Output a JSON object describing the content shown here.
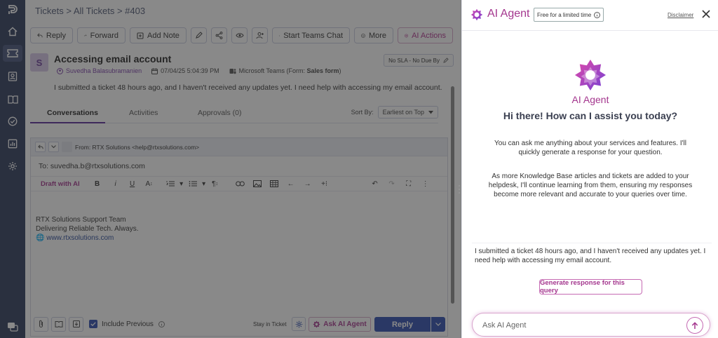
{
  "breadcrumb": {
    "tickets": "Tickets",
    "sep1": " > ",
    "all": "All Tickets",
    "sep2": " > ",
    "id": "#403"
  },
  "toolbar": {
    "reply": "Reply",
    "forward": "Forward",
    "add_note": "Add Note",
    "start_teams_chat": "Start Teams Chat",
    "more": "More",
    "ai_actions": "AI Actions"
  },
  "ticket": {
    "avatar_letter": "S",
    "subject": "Accessing email account",
    "requester": "Suvedha Balasubramanien",
    "datetime": "07/04/25 5:04:39 PM",
    "channel": "Microsoft Teams (Form: ",
    "channel_form": "Sales form",
    "channel_close": ")",
    "sla": "No SLA - No Due By",
    "description": "I submitted a ticket 48 hours ago, and I haven't received any updates yet. I need help with accessing my email account."
  },
  "tabs": {
    "conversations": "Conversations",
    "activities": "Activities",
    "approvals": "Approvals (0)"
  },
  "sort": {
    "label": "Sort By:",
    "value": "Earliest on Top"
  },
  "editor": {
    "from": "From:  RTX Solutions <help@rtxsolutions.com>",
    "to": "To: suvedha.b@rtxsolutions.com",
    "draft_ai": "Draft with AI",
    "signature": {
      "line1": "RTX Solutions Support Team",
      "line2": "Delivering Reliable Tech. Always.",
      "url": "www.rtxsolutions.com"
    },
    "include_previous": "Include Previous",
    "stay_in_ticket": "Stay in Ticket",
    "ask_ai_agent": "Ask AI Agent",
    "reply": "Reply"
  },
  "panel": {
    "title": "AI Agent",
    "badge": "Free for a limited time",
    "disclaimer": "Disclaimer",
    "name": "AI Agent",
    "greeting": "Hi there! How can I assist you today?",
    "para1": "You can ask me anything about your services and features. I'll quickly generate a response for your question.",
    "para2": "As more Knowledge Base articles and tickets are added to your helpdesk, I'll continue learning from them, ensuring my responses become more relevant and accurate to your queries over time.",
    "query": "I submitted a ticket 48 hours ago, and I haven't received any updates yet. I need help with accessing my email account.",
    "generate": "Generate response for this query",
    "input_placeholder": "Ask AI Agent"
  },
  "colors": {
    "accent": "#a4368e",
    "primary": "#2d4db0",
    "nav": "#2e3a5c"
  }
}
